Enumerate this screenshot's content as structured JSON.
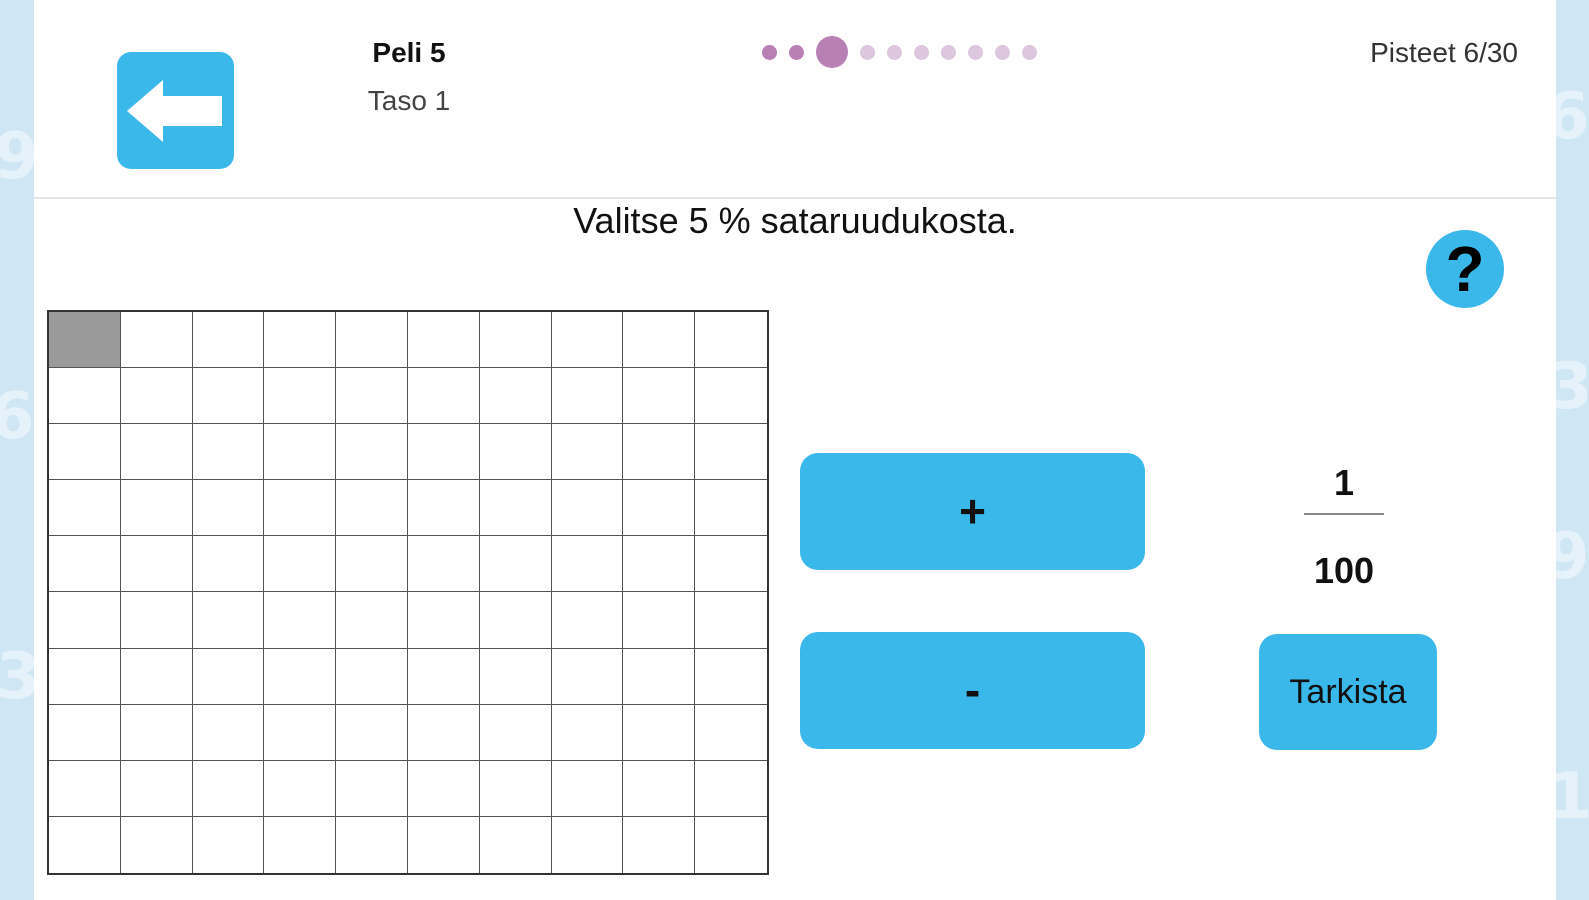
{
  "header": {
    "back_icon": "arrow-left-icon",
    "game_title": "Peli 5",
    "level": "Taso 1",
    "progress": {
      "total_steps": 10,
      "completed": 2,
      "current": 3
    },
    "score": "Pisteet 6/30"
  },
  "question": "Valitse 5 % sataruudukosta.",
  "help_label": "?",
  "grid": {
    "rows": 10,
    "cols": 10,
    "selected_cells": [
      [
        0,
        0
      ]
    ]
  },
  "controls": {
    "plus_label": "+",
    "minus_label": "-",
    "check_label": "Tarkista"
  },
  "fraction": {
    "numerator": "1",
    "denominator": "100"
  },
  "colors": {
    "accent": "#3bb8ea",
    "progress_active": "#b980b6",
    "progress_inactive": "#ddc7de",
    "selected_cell": "#9a9a9a",
    "background": "#cfe6f4"
  }
}
